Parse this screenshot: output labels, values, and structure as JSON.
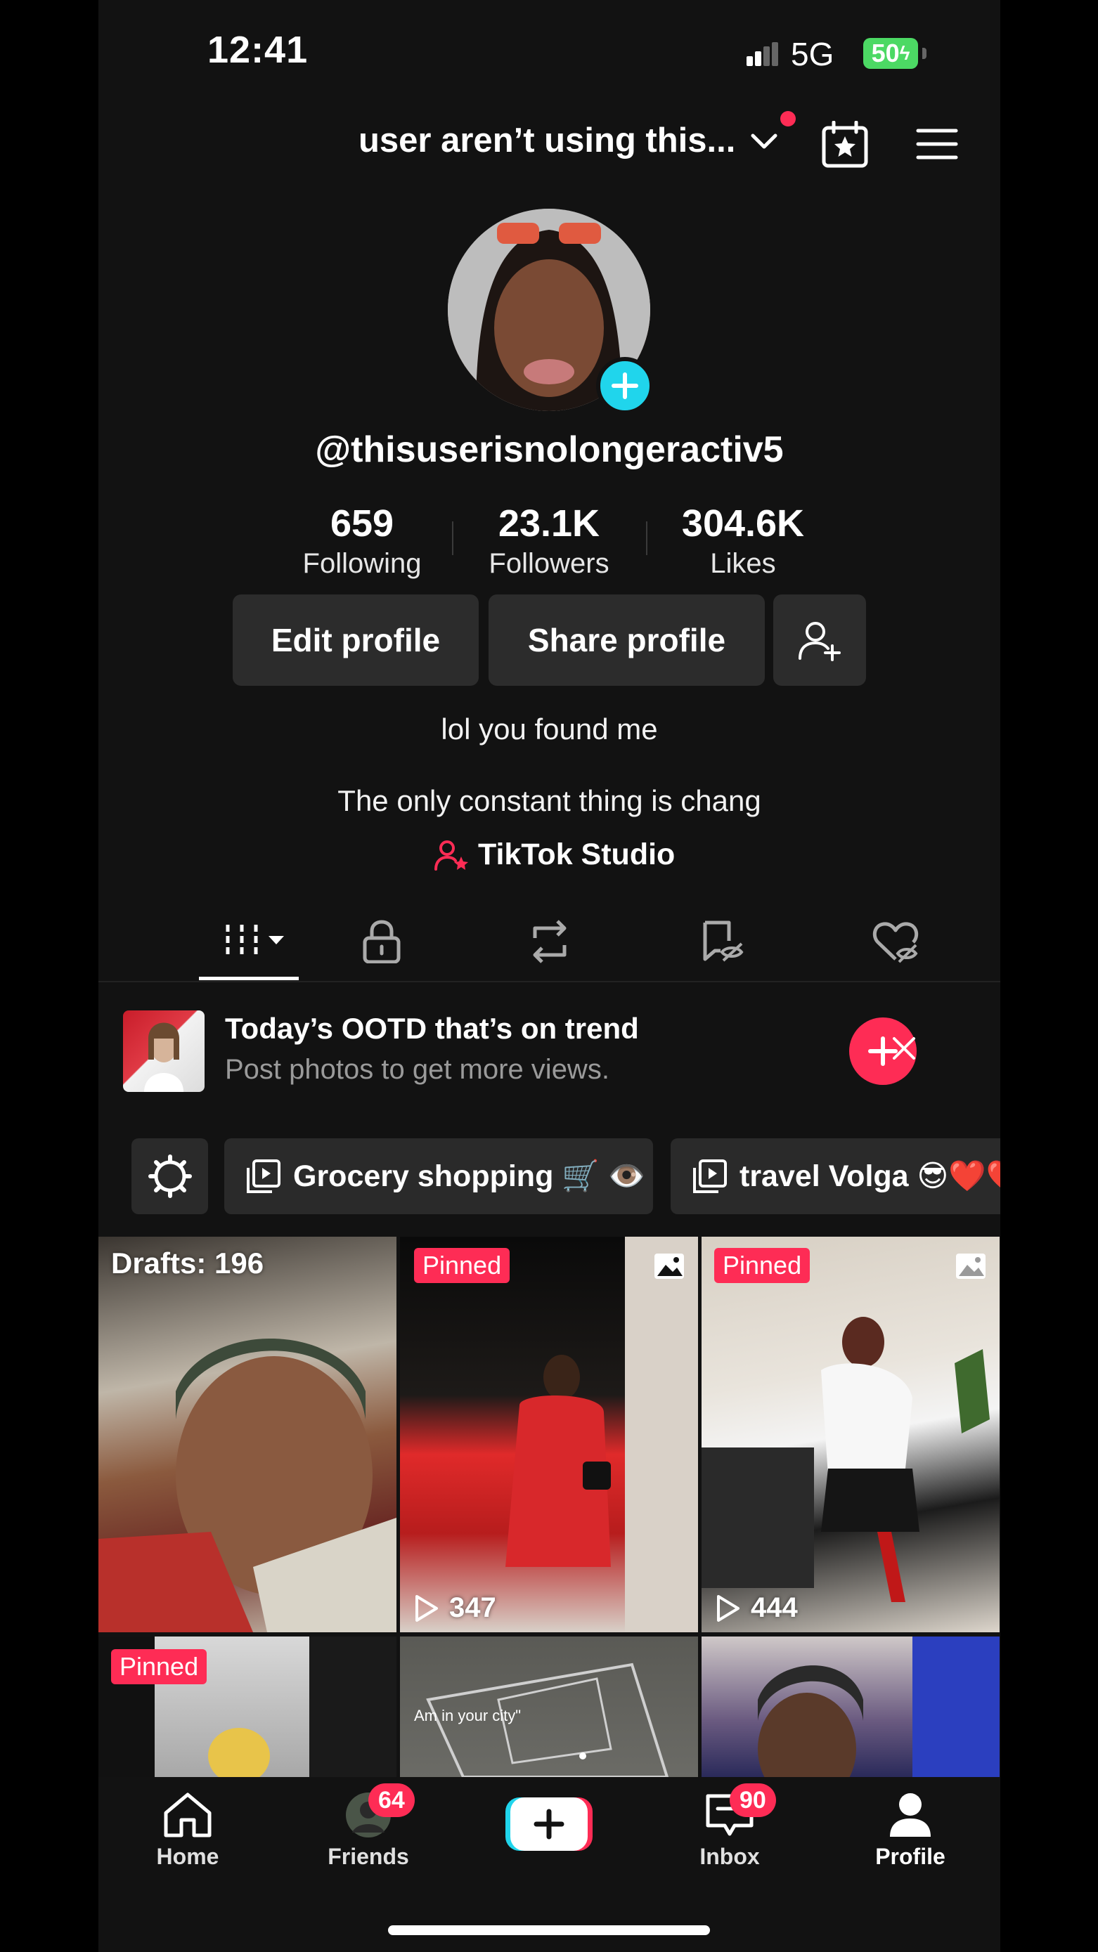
{
  "status_bar": {
    "time": "12:41",
    "network": "5G",
    "battery": "50"
  },
  "header": {
    "account_name": "user aren’t using this...",
    "calendar_icon": "calendar-star-icon",
    "menu_icon": "hamburger-menu-icon"
  },
  "profile": {
    "handle": "@thisuserisnolongeractiv5",
    "stats": [
      {
        "value": "659",
        "label": "Following"
      },
      {
        "value": "23.1K",
        "label": "Followers"
      },
      {
        "value": "304.6K",
        "label": "Likes"
      }
    ],
    "buttons": {
      "edit": "Edit profile",
      "share": "Share profile"
    },
    "bio_line1": "lol you found me",
    "bio_line2": "The only constant thing is chang",
    "studio_label": "TikTok Studio"
  },
  "tabs": [
    "videos-grid-icon",
    "lock-icon",
    "repost-icon",
    "tagged-icon",
    "liked-icon"
  ],
  "promo": {
    "title": "Today’s OOTD that’s on trend",
    "subtitle": "Post photos to get more views."
  },
  "playlists": [
    "Grocery shopping 🛒 👁️",
    "travel Volga 😎❤️❤️"
  ],
  "grid": {
    "drafts": "Drafts: 196",
    "pinned_label": "Pinned",
    "views": [
      "347",
      "444"
    ],
    "caption": "Am in your city\""
  },
  "bottom_nav": {
    "home": "Home",
    "friends": "Friends",
    "friends_badge": "64",
    "inbox": "Inbox",
    "inbox_badge": "90",
    "profile": "Profile"
  },
  "colors": {
    "accent": "#fe2c55",
    "cyan": "#20d5ec",
    "background": "#121212",
    "button": "#2c2c2c"
  }
}
